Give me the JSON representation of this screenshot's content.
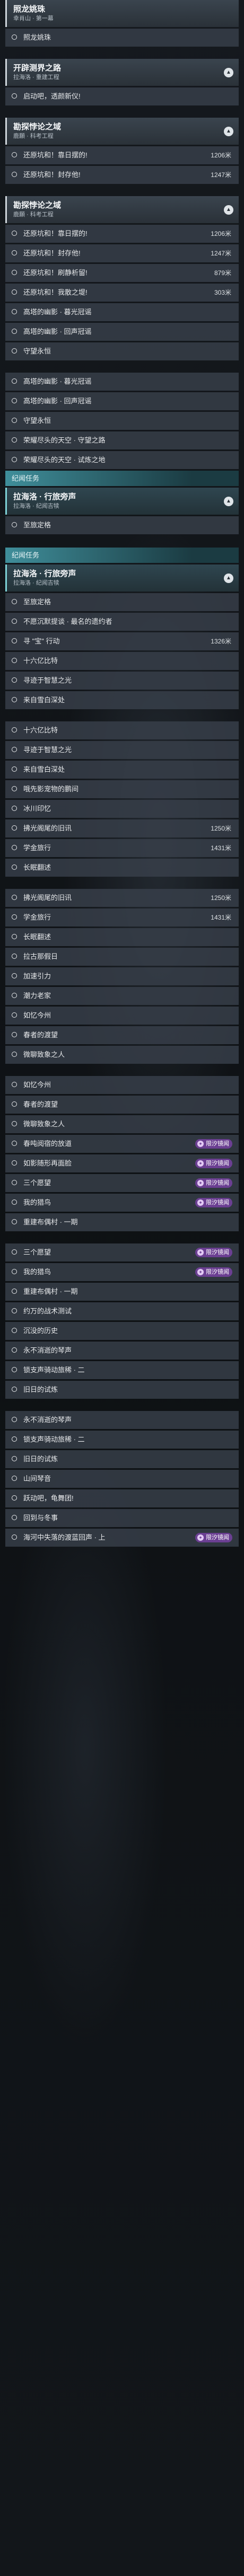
{
  "sections": [
    {
      "type": "header",
      "title": "照龙姚珠",
      "sub": "幸肖山 · 第一幕",
      "chevron": false
    },
    {
      "type": "row",
      "text": "照龙姚珠"
    },
    {
      "type": "gap"
    },
    {
      "type": "header",
      "title": "开辟测界之路",
      "sub": "拉海洛 · 重建工程",
      "chevron": true
    },
    {
      "type": "row",
      "text": "启动吧，透颜新仪!"
    },
    {
      "type": "gap"
    },
    {
      "type": "header",
      "title": "勘探悖论之域",
      "sub": "鹿願 · 科考工程",
      "chevron": true
    },
    {
      "type": "row",
      "text": "还原坑和！靠日摆的!",
      "dist": "1206米"
    },
    {
      "type": "row",
      "text": "还原坑和！封存他!",
      "dist": "1247米"
    },
    {
      "type": "gap"
    },
    {
      "type": "header",
      "title": "勘探悖论之域",
      "sub": "鹿願 · 科考工程",
      "chevron": true
    },
    {
      "type": "row",
      "text": "还原坑和！靠日摆的!",
      "dist": "1206米"
    },
    {
      "type": "row",
      "text": "还原坑和！封存他!",
      "dist": "1247米"
    },
    {
      "type": "row",
      "text": "还原坑和！刷静析留!",
      "dist": "879米"
    },
    {
      "type": "row",
      "text": "还原坑和！我散之堤!",
      "dist": "303米"
    },
    {
      "type": "row",
      "text": "高塔的幽影 · 暮光冠谣"
    },
    {
      "type": "row",
      "text": "高塔的幽影 · 回声冠谣"
    },
    {
      "type": "row",
      "text": "守望永恒"
    },
    {
      "type": "gap"
    },
    {
      "type": "row",
      "text": "高塔的幽影 · 暮光冠谣"
    },
    {
      "type": "row",
      "text": "高塔的幽影 · 回声冠谣"
    },
    {
      "type": "row",
      "text": "守望永恒"
    },
    {
      "type": "row",
      "text": "荣耀尽头的天空 · 守望之路"
    },
    {
      "type": "row",
      "text": "荣耀尽头的天空 · 试炼之地"
    },
    {
      "type": "cat",
      "text": "纪闻任务"
    },
    {
      "type": "header",
      "title": "拉海洛 · 行旅旁声",
      "sub": "拉海洛 · 纪闻吉犊",
      "chevron": true,
      "teal": true
    },
    {
      "type": "row",
      "text": "至旅定格"
    },
    {
      "type": "gap"
    },
    {
      "type": "cat",
      "text": "纪闻任务"
    },
    {
      "type": "header",
      "title": "拉海洛 · 行旅旁声",
      "sub": "拉海洛 · 纪闻吉犊",
      "chevron": true,
      "teal": true
    },
    {
      "type": "row",
      "text": "至旅定格"
    },
    {
      "type": "row",
      "text": "不愿沉默提谈 · 最名的遗约者"
    },
    {
      "type": "row",
      "text": "寻 \"宝\" 行动",
      "dist": "1326米"
    },
    {
      "type": "row",
      "text": "十六亿比特"
    },
    {
      "type": "row",
      "text": "寻迹于智慧之光"
    },
    {
      "type": "row",
      "text": "来自雪白深处"
    },
    {
      "type": "gap"
    },
    {
      "type": "row",
      "text": "十六亿比特"
    },
    {
      "type": "row",
      "text": "寻迹于智慧之光"
    },
    {
      "type": "row",
      "text": "来自雪白深处"
    },
    {
      "type": "row",
      "text": "哦先影宠物的鹏间"
    },
    {
      "type": "row",
      "text": "冰川印忆"
    },
    {
      "type": "row",
      "text": "拂光阁尾的旧讯",
      "dist": "1250米"
    },
    {
      "type": "row",
      "text": "学金旅行",
      "dist": "1431米"
    },
    {
      "type": "row",
      "text": "长眠翻述"
    },
    {
      "type": "gap"
    },
    {
      "type": "row",
      "text": "拂光阁尾的旧讯",
      "dist": "1250米"
    },
    {
      "type": "row",
      "text": "学金旅行",
      "dist": "1431米"
    },
    {
      "type": "row",
      "text": "长眠翻述"
    },
    {
      "type": "row",
      "text": "拉古那假日"
    },
    {
      "type": "row",
      "text": "加速引力"
    },
    {
      "type": "row",
      "text": "潮力老家"
    },
    {
      "type": "row",
      "text": "如忆今州"
    },
    {
      "type": "row",
      "text": "春者的渡望"
    },
    {
      "type": "row",
      "text": "微聊致象之人"
    },
    {
      "type": "gap"
    },
    {
      "type": "row",
      "text": "如忆今州"
    },
    {
      "type": "row",
      "text": "春者的渡望"
    },
    {
      "type": "row",
      "text": "微聊致象之人"
    },
    {
      "type": "row",
      "text": "春吨阅宿的放道",
      "tag": "限汐镜闻"
    },
    {
      "type": "row",
      "text": "如影随形再面脸",
      "tag": "限汐镜闻"
    },
    {
      "type": "row",
      "text": "三个愿望",
      "tag": "限汐镜闻"
    },
    {
      "type": "row",
      "text": "我的猎鸟",
      "tag": "限汐镜闻"
    },
    {
      "type": "row",
      "text": "重建布偶村 · 一期"
    },
    {
      "type": "gap"
    },
    {
      "type": "row",
      "text": "三个愿望",
      "tag": "限汐镜闻"
    },
    {
      "type": "row",
      "text": "我的猎鸟",
      "tag": "限汐镜闻"
    },
    {
      "type": "row",
      "text": "重建布偶村 · 一期"
    },
    {
      "type": "row",
      "text": "约万的战术测试"
    },
    {
      "type": "row",
      "text": "沉没的历史"
    },
    {
      "type": "row",
      "text": "永不消逝的琴声"
    },
    {
      "type": "row",
      "text": "锁支声骑动旅稀 · 二"
    },
    {
      "type": "row",
      "text": "旧日的试炼"
    },
    {
      "type": "gap"
    },
    {
      "type": "row",
      "text": "永不消逝的琴声"
    },
    {
      "type": "row",
      "text": "锁支声骑动旅稀 · 二"
    },
    {
      "type": "row",
      "text": "旧日的试炼"
    },
    {
      "type": "row",
      "text": "山间琴音"
    },
    {
      "type": "row",
      "text": "跃动吧，龟舞团!"
    },
    {
      "type": "row",
      "text": "回到与冬事"
    },
    {
      "type": "row",
      "text": "海河中失落的渡蓝回声 · 上",
      "tag": "限汐镜闻"
    }
  ],
  "colors": {
    "accent": "#3f8e9a",
    "tag": "#6b3f92",
    "row_bg": "#38404a"
  }
}
